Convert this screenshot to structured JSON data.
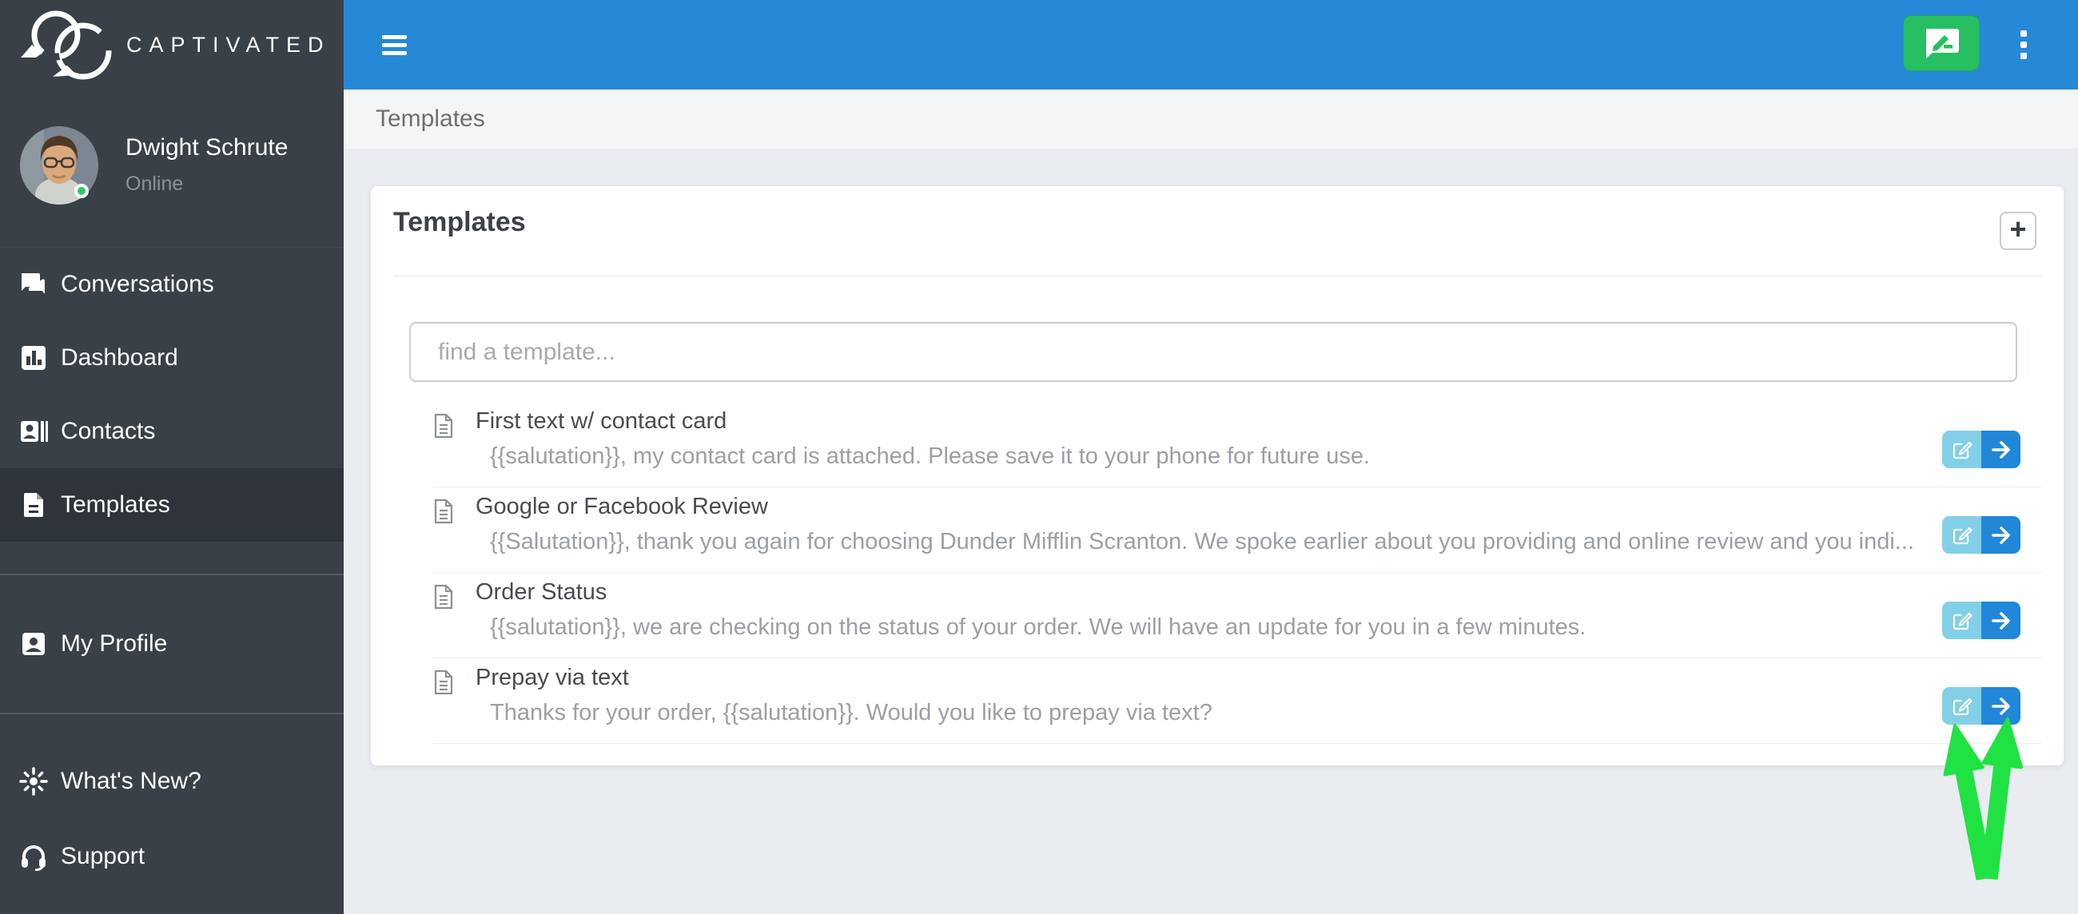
{
  "theme": {
    "header_blue": "#2589d8",
    "sidebar_bg": "#3a4047",
    "sidebar_active": "#2e343a",
    "compose_green": "#26bf61",
    "edit_blue": "#82d0e8",
    "send_blue": "#2187d8",
    "arrow_green": "#21e243",
    "content_bg": "#e9edf2",
    "online_green": "#2bc96a"
  },
  "sidebar": {
    "brand": "CAPTIVATED",
    "user": {
      "name": "Dwight Schrute",
      "status": "Online"
    },
    "items": [
      {
        "label": "Conversations"
      },
      {
        "label": "Dashboard"
      },
      {
        "label": "Contacts"
      },
      {
        "label": "Templates"
      }
    ],
    "secondary_items": [
      {
        "label": "My Profile"
      }
    ],
    "footer_items": [
      {
        "label": "What's New?"
      },
      {
        "label": "Support"
      }
    ]
  },
  "breadcrumb": "Templates",
  "templates_card": {
    "title": "Templates",
    "add_button": "+",
    "search_placeholder": "find a template...",
    "items": [
      {
        "title": "First text w/ contact card",
        "description": "{{salutation}}, my contact card is attached. Please save it to your phone for future use."
      },
      {
        "title": "Google or Facebook Review",
        "description": "{{Salutation}}, thank you again for choosing Dunder Mifflin Scranton. We spoke earlier about you providing and online review and you indi..."
      },
      {
        "title": "Order Status",
        "description": "{{salutation}}, we are checking on the status of your order. We will have an update for you in a few minutes."
      },
      {
        "title": "Prepay via text",
        "description": "Thanks for your order, {{salutation}}. Would you like to prepay via text?"
      }
    ]
  }
}
